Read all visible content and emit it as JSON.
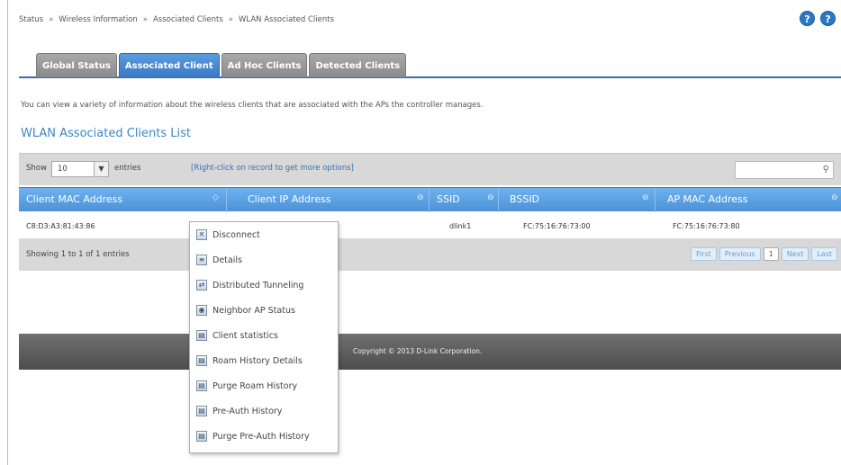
{
  "breadcrumb": [
    "Status",
    "Wireless Information",
    "Associated Clients",
    "WLAN Associated Clients"
  ],
  "help": {
    "icon1": "?",
    "icon2": "?"
  },
  "tabs": [
    {
      "label": "Global Status",
      "active": false
    },
    {
      "label": "Associated Client",
      "active": true
    },
    {
      "label": "Ad Hoc Clients",
      "active": false
    },
    {
      "label": "Detected Clients",
      "active": false
    }
  ],
  "intro_text": "You can view a variety of information about the wireless clients that are associated with the APs the controller manages.",
  "list_title": "WLAN Associated Clients List",
  "toolbar": {
    "show_label": "Show",
    "entries_value": "10",
    "entries_label": "entries",
    "hint": "[Right-click on record to get more options]",
    "search_value": ""
  },
  "table": {
    "columns": [
      "Client MAC Address",
      "Client IP Address",
      "SSID",
      "BSSID",
      "AP MAC Address"
    ],
    "rows": [
      {
        "client_mac": "C8:D3:A3:81:43:86",
        "client_ip": "",
        "ssid": "dlink1",
        "bssid": "FC:75:16:76:73:00",
        "ap_mac": "FC:75:16:76:73:80"
      }
    ]
  },
  "footer": {
    "showing": "Showing 1 to 1 of 1 entries",
    "pager": {
      "first": "First",
      "previous": "Previous",
      "current": "1",
      "next": "Next",
      "last": "Last"
    }
  },
  "copyright": "Copyright © 2013 D-Link Corporation.",
  "context_menu": [
    {
      "label": "Disconnect",
      "icon": "disconnect-icon",
      "glyph": "✕"
    },
    {
      "label": "Details",
      "icon": "details-icon",
      "glyph": "≡"
    },
    {
      "label": "Distributed Tunneling",
      "icon": "tunnel-icon",
      "glyph": "⇄"
    },
    {
      "label": "Neighbor AP Status",
      "icon": "neighbor-ap-icon",
      "glyph": "◉"
    },
    {
      "label": "Client statistics",
      "icon": "statistics-icon",
      "glyph": "▤"
    },
    {
      "label": "Roam History Details",
      "icon": "roam-history-icon",
      "glyph": "▤"
    },
    {
      "label": "Purge Roam History",
      "icon": "purge-roam-icon",
      "glyph": "▤"
    },
    {
      "label": "Pre-Auth History",
      "icon": "preauth-history-icon",
      "glyph": "▤"
    },
    {
      "label": "Purge Pre-Auth History",
      "icon": "purge-preauth-icon",
      "glyph": "▤"
    }
  ]
}
